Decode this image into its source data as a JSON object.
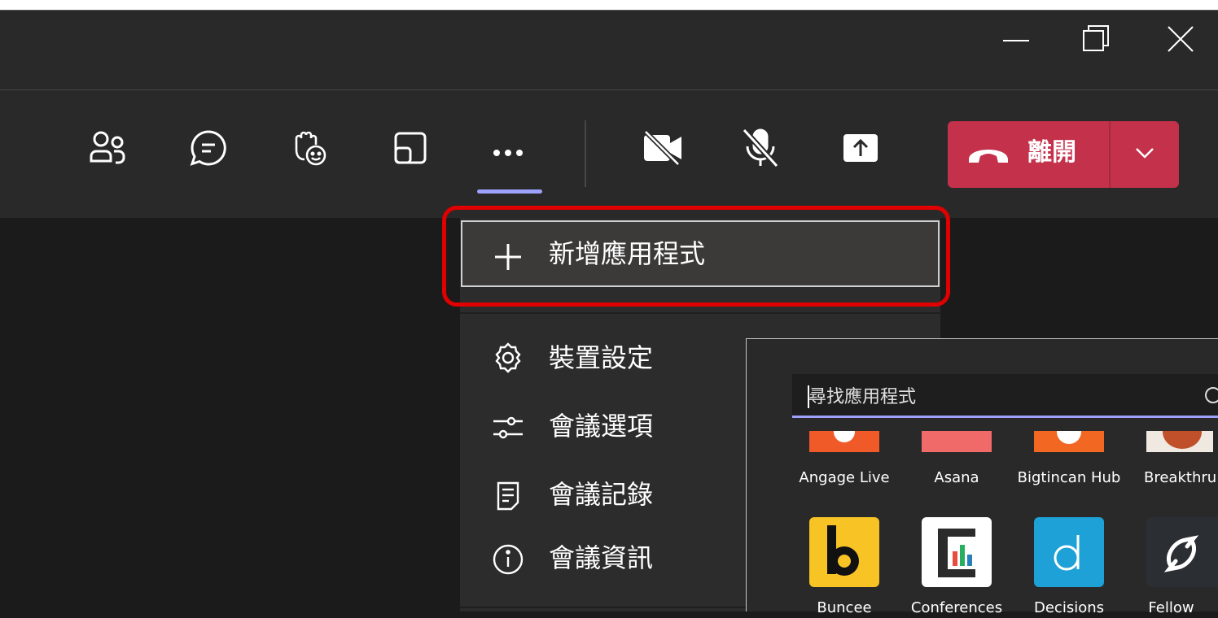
{
  "window": {
    "minimize_icon": "minimize-icon",
    "maximize_icon": "maximize-icon",
    "close_icon": "close-icon"
  },
  "toolbar": {
    "people_icon": "people-icon",
    "chat_icon": "chat-icon",
    "reactions_icon": "raise-hand-icon",
    "rooms_icon": "breakout-rooms-icon",
    "more_icon": "more-icon",
    "camera_icon": "camera-off-icon",
    "mic_icon": "mic-off-icon",
    "share_icon": "share-icon",
    "leave": {
      "label": "離開",
      "icon": "phone-hangup-icon",
      "color": "#c4314b"
    }
  },
  "menu": {
    "add_app": {
      "label": "新增應用程式",
      "icon": "plus-icon"
    },
    "items": [
      {
        "label": "裝置設定",
        "icon": "gear-icon"
      },
      {
        "label": "會議選項",
        "icon": "sliders-icon"
      },
      {
        "label": "會議記錄",
        "icon": "notes-icon"
      },
      {
        "label": "會議資訊",
        "icon": "info-icon"
      }
    ]
  },
  "apps": {
    "search_placeholder": "尋找應用程式",
    "row1": [
      {
        "name": "Angage Live",
        "color": "#f05a28"
      },
      {
        "name": "Asana",
        "color": "#f06a6a"
      },
      {
        "name": "Bigtincan Hub",
        "color": "#f26722"
      },
      {
        "name": "Breakthru",
        "color": "#e8e0d8"
      }
    ],
    "row2": [
      {
        "name": "Buncee",
        "color": "#f7c325"
      },
      {
        "name": "Conferences",
        "color": "#ffffff"
      },
      {
        "name": "Decisions",
        "color": "#1da1d6"
      },
      {
        "name": "Fellow",
        "color": "#2b2f33"
      }
    ]
  }
}
